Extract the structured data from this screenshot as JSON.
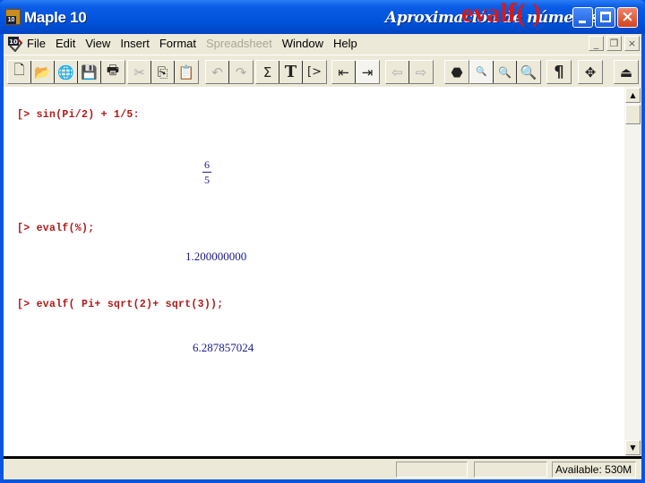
{
  "window": {
    "app_title": "Maple 10",
    "app_icon_badge": "10",
    "slide_title": "Aproximación de números",
    "slide_overlay": "evalf( )",
    "controls": {
      "minimize": "minimize",
      "maximize": "maximize",
      "close": "×"
    }
  },
  "menubar": {
    "items": [
      {
        "label": "File",
        "enabled": true
      },
      {
        "label": "Edit",
        "enabled": true
      },
      {
        "label": "View",
        "enabled": true
      },
      {
        "label": "Insert",
        "enabled": true
      },
      {
        "label": "Format",
        "enabled": true
      },
      {
        "label": "Spreadsheet",
        "enabled": false
      },
      {
        "label": "Window",
        "enabled": true
      },
      {
        "label": "Help",
        "enabled": true
      }
    ],
    "mdi": {
      "minimize": "_",
      "restore": "❐",
      "close": "×"
    }
  },
  "toolbar": {
    "groups": [
      [
        {
          "icon": "new-document-icon",
          "glyph": "🗋"
        },
        {
          "icon": "open-folder-icon",
          "glyph": "📂"
        },
        {
          "icon": "open-url-icon",
          "glyph": "🌐"
        },
        {
          "icon": "save-icon",
          "glyph": "💾"
        },
        {
          "icon": "print-icon",
          "glyph": "🖶"
        }
      ],
      [
        {
          "icon": "cut-icon",
          "glyph": "✂",
          "dim": true
        },
        {
          "icon": "copy-icon",
          "glyph": "⎘"
        },
        {
          "icon": "paste-icon",
          "glyph": "📋"
        }
      ],
      [
        {
          "icon": "undo-icon",
          "glyph": "↶",
          "dim": true
        },
        {
          "icon": "redo-icon",
          "glyph": "↷",
          "dim": true
        }
      ],
      [
        {
          "icon": "math-input-icon",
          "glyph": "Σ"
        },
        {
          "icon": "text-input-icon",
          "glyph": "T"
        },
        {
          "icon": "execution-group-icon",
          "glyph": "[>"
        }
      ],
      [
        {
          "icon": "outdent-icon",
          "glyph": "⇤"
        },
        {
          "icon": "indent-icon",
          "glyph": "⇥",
          "pressed": true
        }
      ],
      [
        {
          "icon": "back-arrow-icon",
          "glyph": "⇦",
          "dim": true
        },
        {
          "icon": "forward-arrow-icon",
          "glyph": "⇨",
          "dim": true
        }
      ],
      [
        {
          "icon": "stop-icon",
          "glyph": "⬣"
        }
      ],
      [
        {
          "icon": "zoom-small-icon",
          "glyph": "🔍",
          "pressed": true
        },
        {
          "icon": "zoom-medium-icon",
          "glyph": "🔍"
        },
        {
          "icon": "zoom-large-icon",
          "glyph": "🔍"
        }
      ],
      [
        {
          "icon": "pilcrow-icon",
          "glyph": "¶"
        }
      ],
      [
        {
          "icon": "move-icon",
          "glyph": "✥"
        }
      ],
      [
        {
          "icon": "restart-icon",
          "glyph": "⏏"
        }
      ]
    ]
  },
  "worksheet": {
    "blocks": [
      {
        "input": "[> sin(Pi/2) + 1/5:",
        "output_fraction": {
          "numerator": "6",
          "denominator": "5"
        }
      },
      {
        "input": "[> evalf(%);",
        "output": "1.200000000"
      },
      {
        "input": "[> evalf( Pi+ sqrt(2)+ sqrt(3));",
        "output": "6.287857024"
      }
    ]
  },
  "statusbar": {
    "panels": [
      "",
      "",
      ""
    ],
    "memory": "Available: 530M"
  }
}
